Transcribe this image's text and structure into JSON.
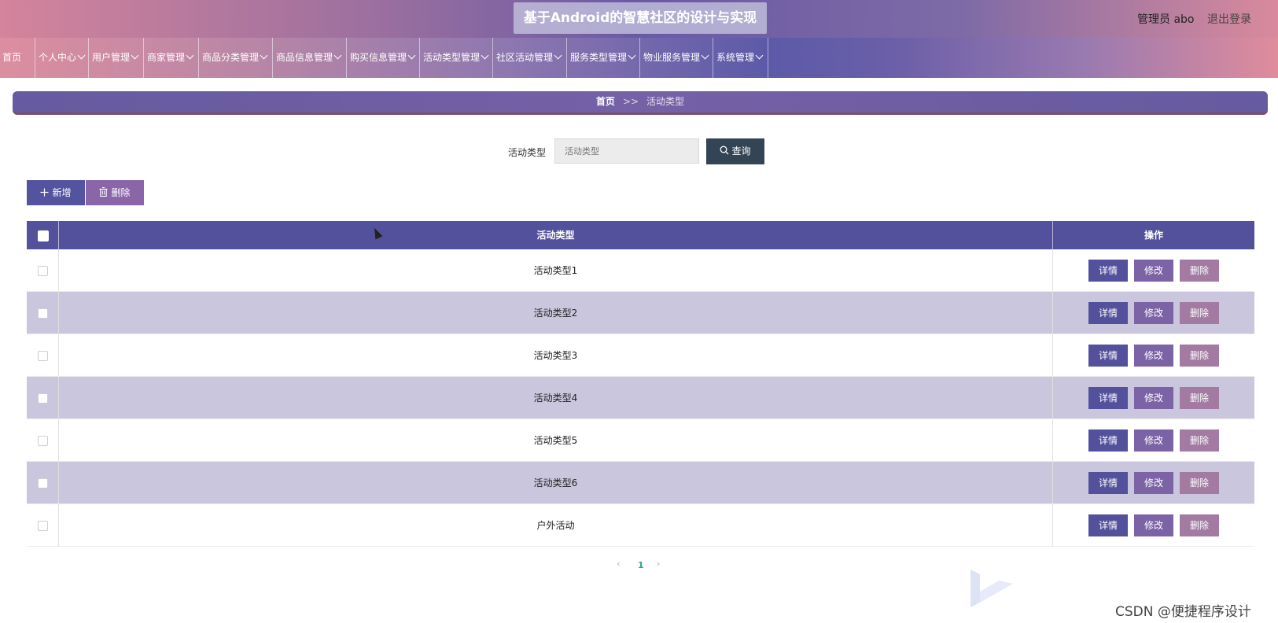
{
  "header": {
    "title": "基于Android的智慧社区的设计与实现",
    "user_label": "管理员 abo",
    "logout": "退出登录"
  },
  "nav": [
    {
      "label": "首页",
      "dropdown": false
    },
    {
      "label": "个人中心",
      "dropdown": true
    },
    {
      "label": "用户管理",
      "dropdown": true
    },
    {
      "label": "商家管理",
      "dropdown": true
    },
    {
      "label": "商品分类管理",
      "dropdown": true
    },
    {
      "label": "商品信息管理",
      "dropdown": true
    },
    {
      "label": "购买信息管理",
      "dropdown": true
    },
    {
      "label": "活动类型管理",
      "dropdown": true
    },
    {
      "label": "社区活动管理",
      "dropdown": true
    },
    {
      "label": "服务类型管理",
      "dropdown": true
    },
    {
      "label": "物业服务管理",
      "dropdown": true
    },
    {
      "label": "系统管理",
      "dropdown": true
    }
  ],
  "breadcrumb": {
    "home": "首页",
    "separator": ">>",
    "current": "活动类型"
  },
  "search": {
    "label": "活动类型",
    "placeholder": "活动类型",
    "button": "查询"
  },
  "actions": {
    "add": "新增",
    "delete": "删除"
  },
  "table": {
    "columns": [
      "活动类型",
      "操作"
    ],
    "rows": [
      "活动类型1",
      "活动类型2",
      "活动类型3",
      "活动类型4",
      "活动类型5",
      "活动类型6",
      "户外活动"
    ],
    "row_actions": {
      "detail": "详情",
      "edit": "修改",
      "delete": "删除"
    }
  },
  "pagination": {
    "current": "1",
    "prev": "‹",
    "next": "›"
  },
  "watermark": "CSDN @便捷程序设计",
  "colors": {
    "primary": "#54519c",
    "secondary": "#7b63a6",
    "danger": "#a27aa2",
    "search_button": "#334455"
  }
}
